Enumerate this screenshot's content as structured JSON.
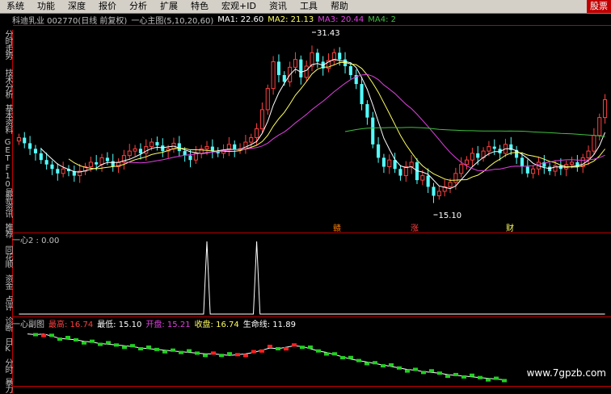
{
  "menu": [
    "系统",
    "功能",
    "深度",
    "报价",
    "分析",
    "扩展",
    "特色",
    "宏观+ID",
    "资讯",
    "工具",
    "帮助"
  ],
  "menu_alert": "股票",
  "sidebar": [
    "分时走势",
    "技术分析",
    "基本资料",
    "GET",
    "F10",
    "最新资讯",
    "推荐",
    "同花顺",
    "资金",
    "点评",
    "诊断",
    "日K",
    "分时",
    "暴力"
  ],
  "main_header": {
    "stock": "科迪乳业 002770(日线 前复权)",
    "indicator": "一心主图(5,10,20,60)",
    "ma1_label": "MA1: 22.60",
    "ma2_label": "MA2: 21.13",
    "ma3_label": "MA3: 20.44",
    "ma4_label": "MA4: 2"
  },
  "annotations": {
    "high_label": "31.43",
    "low_label": "15.10",
    "markers": [
      "赣",
      "涨",
      "财"
    ]
  },
  "sub1_header": {
    "label": "一心2 : 0.00"
  },
  "sub2_header": {
    "name": "一心副图",
    "high_label": "最高: 16.74",
    "low_label": "最低: 15.10",
    "open_label": "开盘: 15.21",
    "close_label": "收盘: 16.74",
    "life_label": "生命线: 11.89"
  },
  "watermark": "www.7gpzb.com",
  "colors": {
    "up": "#ff4040",
    "down": "#54ffff",
    "ma1": "#ffffff",
    "ma2": "#ffff60",
    "ma3": "#e040e0",
    "ma4": "#40c040",
    "divider": "#c00000",
    "sub2_up": "#ff2020",
    "sub2_down": "#20d020"
  },
  "chart_data": [
    {
      "type": "candlestick",
      "title": "科迪乳业 002770(日线 前复权)",
      "ylim": [
        15.1,
        31.43
      ],
      "series": [
        {
          "name": "MA1",
          "value": 22.6
        },
        {
          "name": "MA2",
          "value": 21.13
        },
        {
          "name": "MA3",
          "value": 20.44
        }
      ],
      "closes": [
        22.0,
        21.5,
        21.0,
        20.6,
        20.0,
        19.6,
        19.2,
        18.8,
        19.2,
        19.0,
        18.6,
        19.0,
        19.4,
        19.8,
        19.6,
        20.2,
        19.9,
        19.4,
        19.8,
        20.4,
        20.8,
        21.0,
        20.6,
        21.2,
        21.6,
        21.3,
        20.8,
        21.0,
        21.5,
        20.8,
        20.4,
        20.0,
        20.6,
        21.0,
        21.2,
        20.8,
        20.6,
        20.9,
        21.4,
        20.9,
        21.0,
        21.6,
        22.0,
        22.8,
        24.5,
        26.4,
        28.8,
        27.6,
        27.0,
        28.3,
        29.0,
        27.4,
        28.4,
        29.6,
        28.8,
        28.2,
        28.9,
        29.6,
        29.0,
        28.4,
        27.6,
        26.8,
        25.0,
        23.8,
        21.4,
        20.2,
        19.4,
        20.0,
        19.2,
        18.6,
        19.4,
        19.8,
        18.2,
        18.6,
        17.6,
        16.8,
        17.2,
        17.6,
        18.0,
        18.8,
        19.6,
        20.0,
        20.6,
        20.2,
        20.8,
        21.2,
        21.0,
        20.6,
        21.4,
        20.9,
        20.2,
        19.4,
        18.8,
        19.2,
        19.8,
        19.4,
        19.0,
        19.5,
        19.2,
        19.6,
        19.8,
        19.4,
        20.2,
        20.8,
        22.2,
        23.8,
        25.4
      ]
    },
    {
      "type": "line",
      "title": "一心2",
      "values": [
        0,
        0,
        0,
        0,
        0,
        0,
        0,
        0,
        0,
        0,
        0,
        0,
        0,
        0,
        0,
        0,
        0,
        0,
        0,
        0,
        0,
        0,
        0,
        0,
        0,
        0,
        0,
        0,
        0,
        0,
        0,
        0,
        0,
        0,
        1,
        0,
        0,
        0,
        0,
        0,
        0,
        0,
        0,
        1,
        0,
        0,
        0,
        0,
        0,
        0,
        0,
        0,
        0,
        0,
        0,
        0,
        0,
        0,
        0,
        0,
        0,
        0,
        0,
        0,
        0,
        0,
        0,
        0,
        0,
        0,
        0,
        0,
        0,
        0,
        0,
        0,
        0,
        0,
        0,
        0,
        0,
        0,
        0,
        0,
        0,
        0,
        0,
        0,
        0,
        0,
        0,
        0,
        0,
        0,
        0,
        0,
        0,
        0,
        0,
        0,
        0,
        0,
        0,
        0,
        0,
        0,
        0
      ]
    },
    {
      "type": "line",
      "title": "一心副图",
      "values": [
        12.6,
        12.5,
        12.6,
        12.3,
        12.0,
        11.9,
        11.8,
        11.6,
        11.5,
        11.3,
        11.2,
        11.1,
        11.0,
        10.9,
        10.7,
        10.6,
        10.5,
        10.4,
        10.3,
        10.2,
        10.1,
        10.0,
        9.9,
        9.9,
        9.8,
        9.7,
        9.8,
        9.9,
        10.1,
        10.4,
        10.7,
        10.6,
        10.8,
        11.0,
        10.9,
        10.6,
        10.3,
        10.1,
        9.8,
        9.5,
        9.2,
        9.0,
        8.8,
        8.6,
        8.4,
        8.2,
        8.0,
        7.8,
        7.7,
        7.5,
        7.4,
        7.3,
        7.1,
        7.0,
        6.9,
        6.8,
        6.7,
        6.6,
        6.5,
        6.4
      ]
    }
  ]
}
